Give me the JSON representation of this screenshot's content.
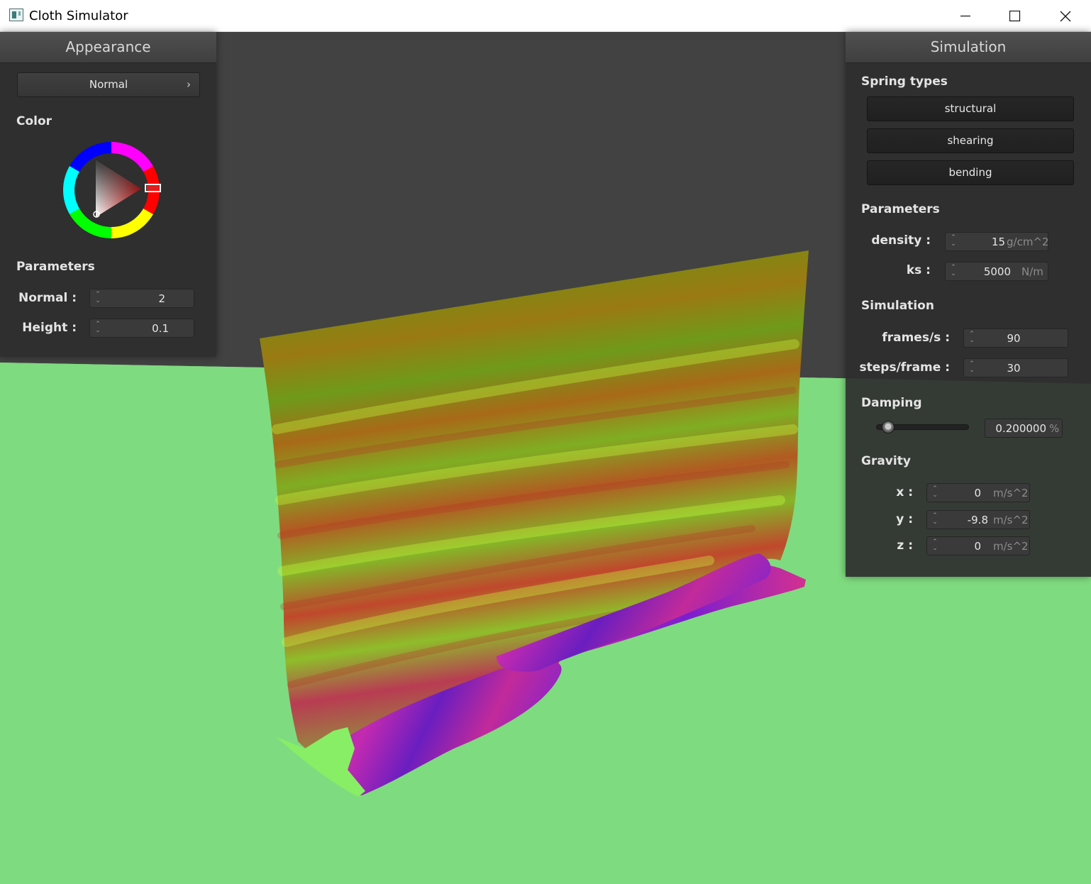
{
  "window": {
    "title": "Cloth Simulator",
    "minimize": "—",
    "maximize": "☐",
    "close": "✕"
  },
  "appearance": {
    "header": "Appearance",
    "shader_button": {
      "label": "Normal",
      "chevron": "›"
    },
    "color_label": "Color",
    "color_value": "#e02020",
    "parameters_label": "Parameters",
    "normal": {
      "label": "Normal :",
      "value": "2"
    },
    "height": {
      "label": "Height :",
      "value": "0.1"
    }
  },
  "simulation": {
    "header": "Simulation",
    "spring_types_label": "Spring types",
    "springs": [
      "structural",
      "shearing",
      "bending"
    ],
    "parameters_label": "Parameters",
    "density": {
      "label": "density :",
      "value": "15",
      "unit": "g/cm^2"
    },
    "ks": {
      "label": "ks :",
      "value": "5000",
      "unit": "N/m"
    },
    "simulation_label": "Simulation",
    "fps": {
      "label": "frames/s :",
      "value": "90"
    },
    "steps": {
      "label": "steps/frame :",
      "value": "30"
    },
    "damping_label": "Damping",
    "damping": {
      "value": "0.200000",
      "unit": "%",
      "fraction": 0.2
    },
    "gravity_label": "Gravity",
    "gravity": [
      {
        "label": "x :",
        "value": "0",
        "unit": "m/s^2"
      },
      {
        "label": "y :",
        "value": "-9.8",
        "unit": "m/s^2"
      },
      {
        "label": "z :",
        "value": "0",
        "unit": "m/s^2"
      }
    ]
  },
  "scene": {
    "background_color": "#424242",
    "floor_color": "#7fdb7f"
  }
}
